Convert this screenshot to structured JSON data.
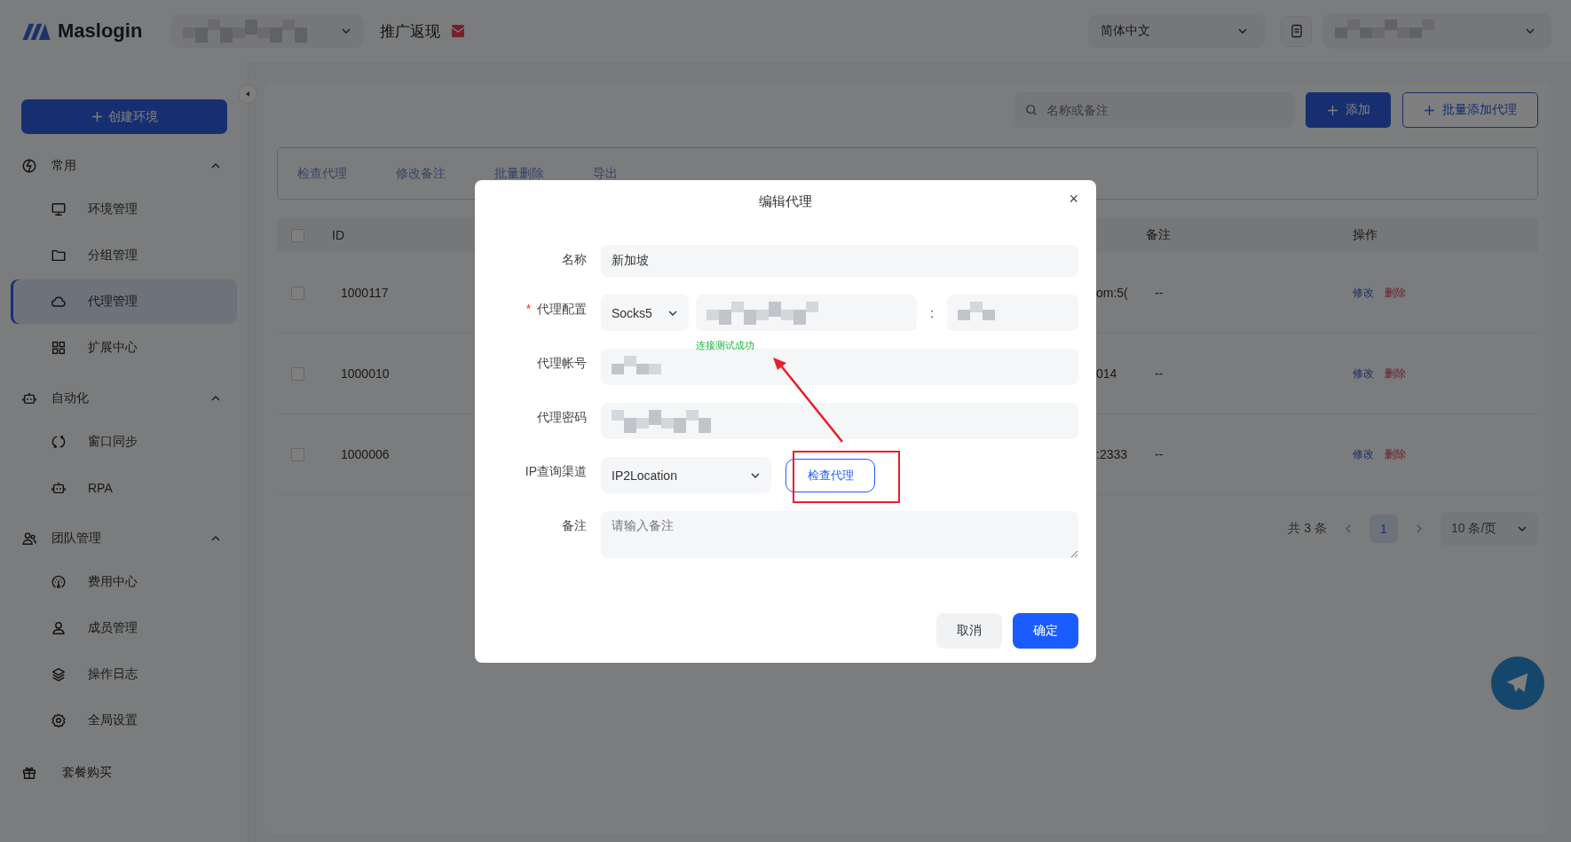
{
  "header": {
    "logo": "Maslogin",
    "promo_link": "推广返现",
    "language": "简体中文"
  },
  "sidebar": {
    "create_button": "创建环境",
    "collapsed": false,
    "nav": [
      {
        "kind": "section",
        "label": "常用",
        "expanded": true,
        "children": [
          {
            "label": "环境管理",
            "selected": false
          },
          {
            "label": "分组管理",
            "selected": false
          },
          {
            "label": "代理管理",
            "selected": true
          },
          {
            "label": "扩展中心",
            "selected": false
          }
        ]
      },
      {
        "kind": "section",
        "label": "自动化",
        "expanded": true,
        "children": [
          {
            "label": "窗口同步",
            "selected": false
          },
          {
            "label": "RPA",
            "selected": false
          }
        ]
      },
      {
        "kind": "section",
        "label": "团队管理",
        "expanded": true,
        "children": [
          {
            "label": "费用中心",
            "selected": false
          },
          {
            "label": "成员管理",
            "selected": false
          },
          {
            "label": "操作日志",
            "selected": false
          },
          {
            "label": "全局设置",
            "selected": false
          }
        ]
      },
      {
        "kind": "link",
        "label": "套餐购买"
      }
    ]
  },
  "toolbar": {
    "search": {
      "placeholder": "名称或备注"
    },
    "add_button": "添加",
    "batch_add_button": "批量添加代理",
    "actions": [
      "检查代理",
      "修改备注",
      "批量删除",
      "导出"
    ]
  },
  "table": {
    "columns": [
      "ID",
      "备注",
      "操作"
    ],
    "all_checked": false,
    "rows": [
      {
        "checked": false,
        "id": "1000117",
        "column_3": "om:5(",
        "remark": "--",
        "actions": [
          "修改",
          "删除"
        ]
      },
      {
        "checked": false,
        "id": "1000010",
        "column_3": "014",
        "remark": "--",
        "actions": [
          "修改",
          "删除"
        ]
      },
      {
        "checked": false,
        "id": "1000006",
        "column_3": ":2333",
        "remark": "--",
        "actions": [
          "修改",
          "删除"
        ]
      }
    ]
  },
  "pagination": {
    "total": "共 3 条",
    "pages": [
      {
        "label": "1",
        "selected": true
      }
    ],
    "page_size": "10 条/页"
  },
  "dialog": {
    "title": "编辑代理",
    "close": "×",
    "fields": [
      {
        "kind": "input",
        "label": "名称",
        "value": "新加坡"
      },
      {
        "kind": "proxy",
        "label": "代理配置",
        "required_mark": "*",
        "protocol": "Socks5",
        "separator": ":",
        "status": "连接测试成功"
      },
      {
        "kind": "masked",
        "label": "代理帐号"
      },
      {
        "kind": "masked",
        "label": "代理密码"
      },
      {
        "kind": "select_button",
        "label": "IP查询渠道",
        "value": "IP2Location",
        "button": "检查代理"
      },
      {
        "kind": "textarea",
        "label": "备注",
        "placeholder": "请输入备注"
      }
    ],
    "buttons": [
      {
        "label": "取消",
        "primary": false
      },
      {
        "label": "确定",
        "primary": true
      }
    ]
  }
}
